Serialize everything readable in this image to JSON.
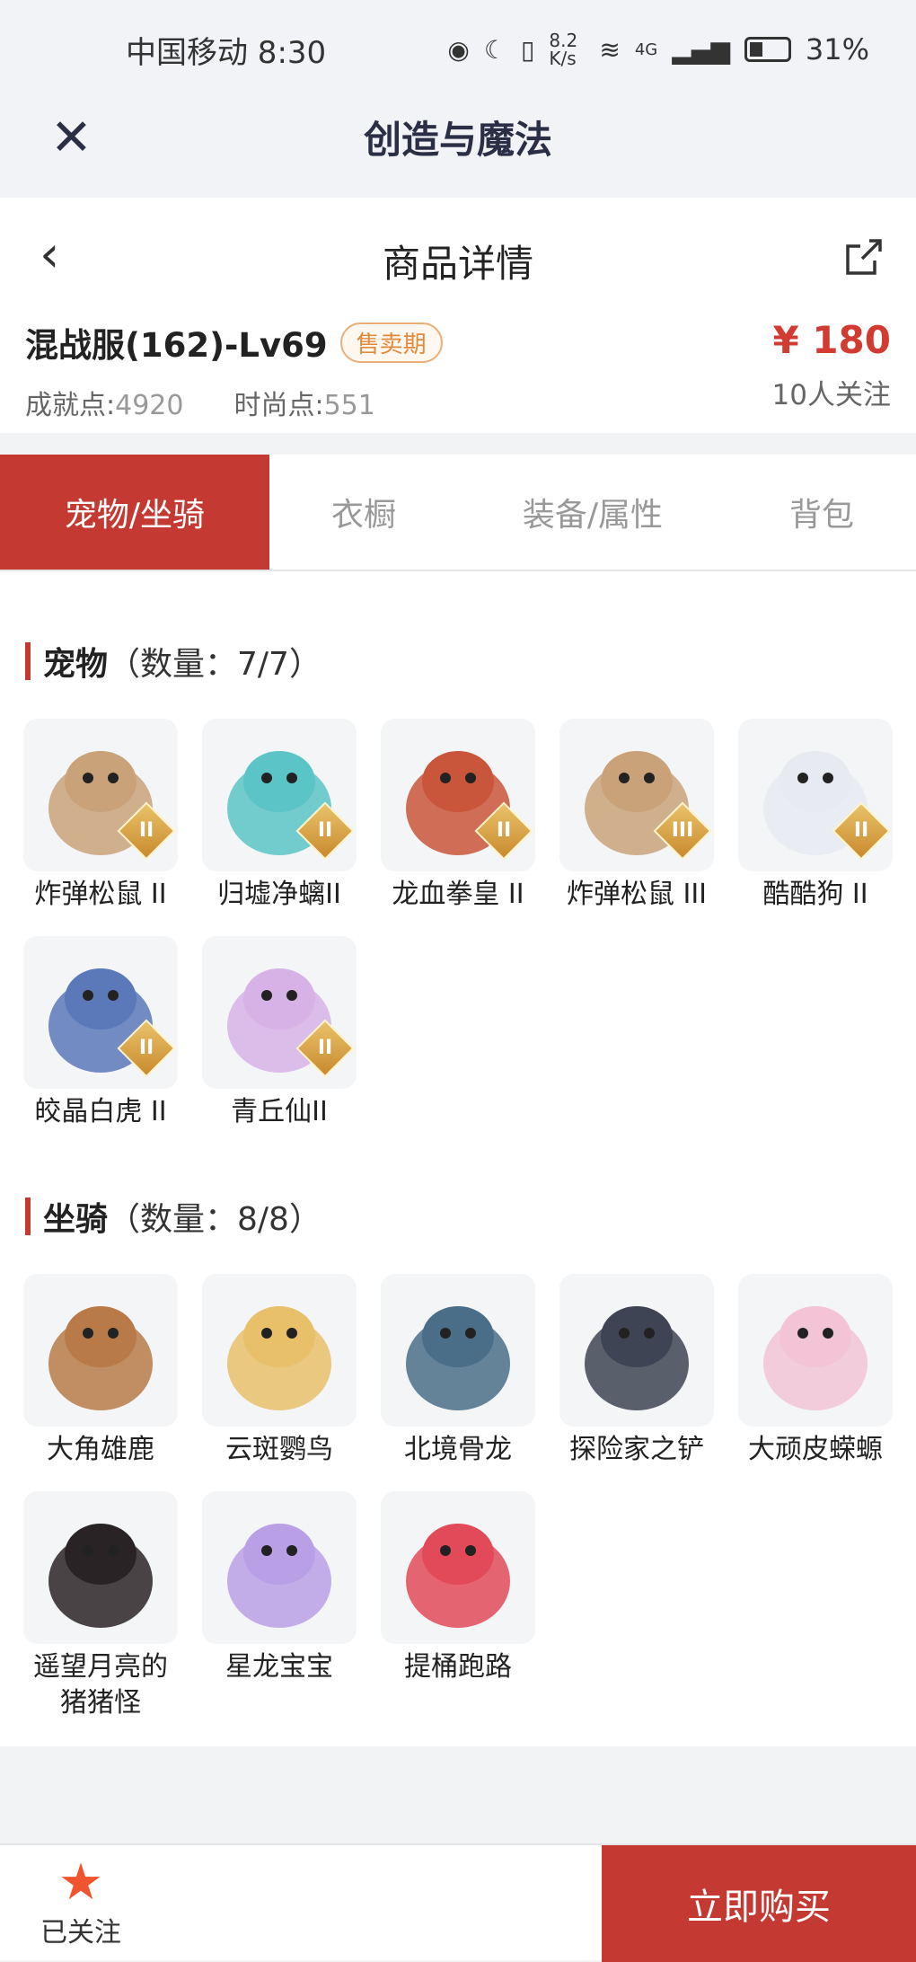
{
  "status_bar": {
    "carrier_time": "中国移动 8:30",
    "speed": "8.2 K/s",
    "network": "4G",
    "battery": "31%"
  },
  "app_bar": {
    "title": "创造与魔法"
  },
  "nav": {
    "title": "商品详情"
  },
  "goods": {
    "name": "混战服(162)-Lv69",
    "badge": "售卖期",
    "achievement_label": "成就点:",
    "achievement_value": "4920",
    "fashion_label": "时尚点:",
    "fashion_value": "551",
    "price": "¥ 180",
    "followers": "10人关注"
  },
  "tabs": [
    "宠物/坐骑",
    "衣橱",
    "装备/属性",
    "背包"
  ],
  "pets": {
    "title": "宠物",
    "count": "（数量：7/7）",
    "items": [
      {
        "name": "炸弹松鼠 II",
        "rank": "II",
        "icon": "squirrel-icon",
        "color": "#c9a27a"
      },
      {
        "name": "归墟净螭II",
        "rank": "II",
        "icon": "dragon-icon",
        "color": "#5bc4c7"
      },
      {
        "name": "龙血拳皇 II",
        "rank": "II",
        "icon": "bull-icon",
        "color": "#c9553a"
      },
      {
        "name": "炸弹松鼠 III",
        "rank": "III",
        "icon": "squirrel-icon",
        "color": "#c9a27a"
      },
      {
        "name": "酷酷狗 II",
        "rank": "II",
        "icon": "dog-icon",
        "color": "#e8eaf2"
      },
      {
        "name": "皎晶白虎 II",
        "rank": "II",
        "icon": "tiger-icon",
        "color": "#5b78b9"
      },
      {
        "name": "青丘仙II",
        "rank": "II",
        "icon": "fox-fairy-icon",
        "color": "#d7b2e6"
      }
    ]
  },
  "mounts": {
    "title": "坐骑",
    "count": "（数量：8/8）",
    "items": [
      {
        "name": "大角雄鹿",
        "icon": "stag-icon",
        "color": "#b77a48"
      },
      {
        "name": "云斑鹦鸟",
        "icon": "parrot-icon",
        "color": "#e8c06a"
      },
      {
        "name": "北境骨龙",
        "icon": "bone-dragon-icon",
        "color": "#4a6e88"
      },
      {
        "name": "探险家之铲",
        "icon": "shovel-icon",
        "color": "#3e4453"
      },
      {
        "name": "大顽皮蝾螈",
        "icon": "axolotl-icon",
        "color": "#f2c4d6"
      },
      {
        "name": "遥望月亮的猪猪怪",
        "icon": "pig-icon",
        "color": "#2a2326"
      },
      {
        "name": "星龙宝宝",
        "icon": "baby-dragon-icon",
        "color": "#b9a0e6"
      },
      {
        "name": "提桶跑路",
        "icon": "bucket-icon",
        "color": "#e24a5a"
      }
    ]
  },
  "bottom": {
    "followed_label": "已关注",
    "buy_label": "立即购买"
  }
}
